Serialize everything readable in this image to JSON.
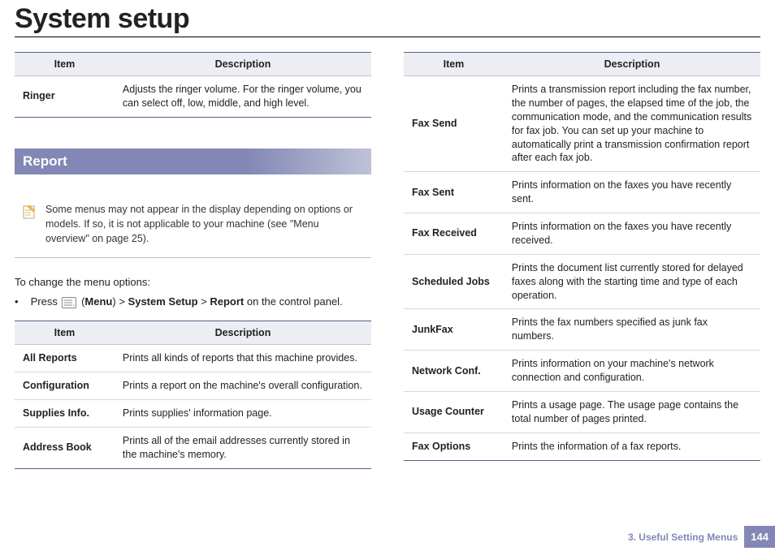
{
  "title": "System setup",
  "table_ringer": {
    "headers": [
      "Item",
      "Description"
    ],
    "row": {
      "k": "Ringer",
      "v": "Adjusts the ringer volume. For the ringer volume, you can select off, low, middle, and high level."
    }
  },
  "section_report": "Report",
  "note_text": "Some menus may not appear in the display depending on options or models. If so, it is not applicable to your machine (see \"Menu overview\" on page 25).",
  "intro": "To change the menu options:",
  "step": {
    "prefix": "Press ",
    "menu_label": "Menu",
    "gt": ">",
    "seg1": "System Setup",
    "seg2": "Report",
    "suffix": " on the control panel."
  },
  "table_report": {
    "headers": [
      "Item",
      "Description"
    ],
    "rows": [
      {
        "k": "All Reports",
        "v": "Prints all kinds of reports that this machine provides."
      },
      {
        "k": "Configuration",
        "v": "Prints a report on the machine's overall configuration."
      },
      {
        "k": "Supplies Info.",
        "v": "Prints supplies' information page."
      },
      {
        "k": "Address Book",
        "v": "Prints all of the email addresses currently stored in the machine's memory."
      }
    ]
  },
  "table_fax": {
    "headers": [
      "Item",
      "Description"
    ],
    "rows": [
      {
        "k": "Fax Send",
        "v": "Prints a transmission report including the fax number, the number of pages, the elapsed time of the job, the communication mode, and the communication results for fax job. You can set up your machine to automatically print a transmission confirmation report after each fax job."
      },
      {
        "k": "Fax Sent",
        "v": "Prints information on the faxes you have recently sent."
      },
      {
        "k": "Fax Received",
        "v": "Prints information on the faxes you have recently received."
      },
      {
        "k": "Scheduled Jobs",
        "v": "Prints the document list currently stored for delayed faxes along with the starting time and type of each operation."
      },
      {
        "k": "JunkFax",
        "v": "Prints the fax numbers specified as junk fax numbers."
      },
      {
        "k": "Network Conf.",
        "v": "Prints information on your machine's network connection and configuration."
      },
      {
        "k": "Usage Counter",
        "v": "Prints a usage page. The usage page contains the total number of pages printed."
      },
      {
        "k": "Fax Options",
        "v": "Prints the information of a fax reports."
      }
    ]
  },
  "footer": {
    "chapter": "3.  Useful Setting Menus",
    "page": "144"
  }
}
